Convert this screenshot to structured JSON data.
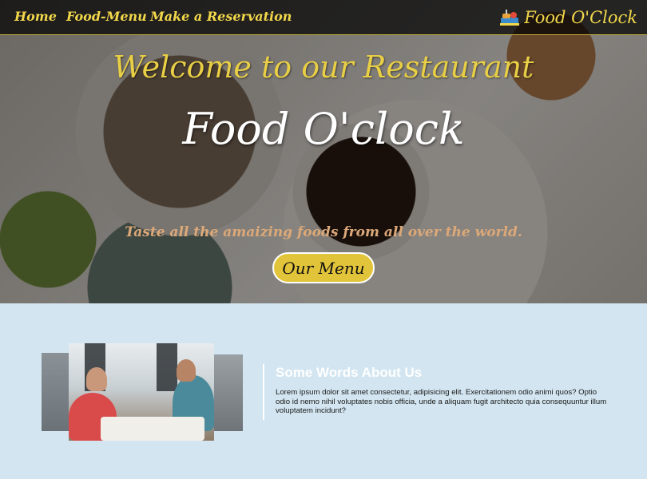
{
  "nav": {
    "links": [
      "Home",
      "Food-Menu",
      "Make a Reservation"
    ],
    "brand": "Food O'Clock",
    "brand_icon": "food-tray-icon"
  },
  "hero": {
    "welcome": "Welcome to our Restaurant",
    "title": "Food O'clock",
    "tagline": "Taste all the amaizing foods from all over the world.",
    "button_label": "Our Menu"
  },
  "about": {
    "heading": "Some Words About Us",
    "text": "Lorem ipsum dolor sit amet consectetur, adipisicing elit. Exercitationem odio animi quos? Optio odio id nemo nihil voluptates nobis officia, unde a aliquam fugit architecto quia consequuntur illum voluptatem incidunt?"
  },
  "colors": {
    "accent_yellow": "#f2d84a",
    "button_yellow": "#e2c43a",
    "tagline": "#dca878",
    "section_bg": "#d2e5f0"
  }
}
